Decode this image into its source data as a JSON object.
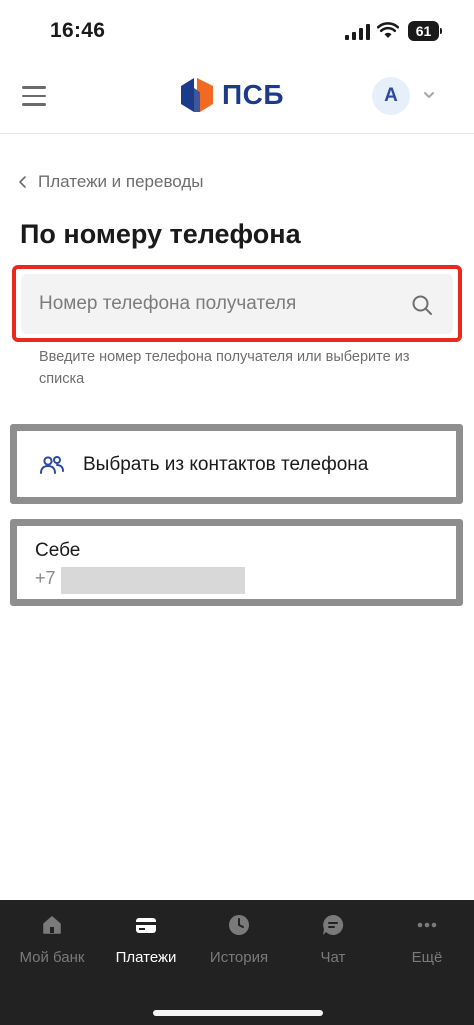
{
  "status_bar": {
    "time": "16:46",
    "battery": "61"
  },
  "header": {
    "logo_text": "ПСБ",
    "brand_color": "#1c3a8a",
    "brand_accent": "#f26a21",
    "avatar_letter": "А"
  },
  "breadcrumb": {
    "label": "Платежи и переводы"
  },
  "page": {
    "title": "По номеру телефона"
  },
  "search": {
    "value": "",
    "placeholder": "Номер телефона получателя",
    "helper": "Введите номер телефона получателя или выберите из списка",
    "highlight_color": "#e8291c"
  },
  "contacts_option": {
    "label": "Выбрать из контактов телефона"
  },
  "self_option": {
    "title": "Себе",
    "phone_prefix": "+7"
  },
  "tab_bar": {
    "tabs": [
      {
        "label": "Мой банк",
        "icon": "home-icon",
        "active": false
      },
      {
        "label": "Платежи",
        "icon": "card-icon",
        "active": true
      },
      {
        "label": "История",
        "icon": "clock-icon",
        "active": false
      },
      {
        "label": "Чат",
        "icon": "chat-icon",
        "active": false
      },
      {
        "label": "Ещё",
        "icon": "more-icon",
        "active": false
      }
    ]
  }
}
